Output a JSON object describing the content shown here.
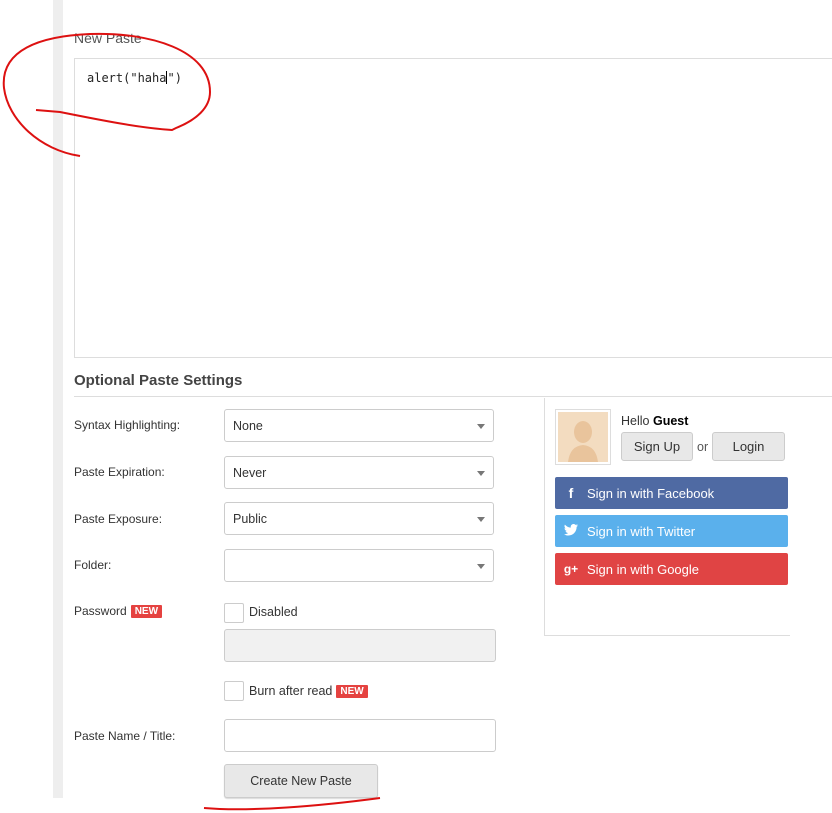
{
  "new_paste": {
    "title": "New Paste",
    "content": "alert(\"haha\")"
  },
  "settings": {
    "title": "Optional Paste Settings",
    "syntax_label": "Syntax Highlighting:",
    "syntax_value": "None",
    "expiration_label": "Paste Expiration:",
    "expiration_value": "Never",
    "exposure_label": "Paste Exposure:",
    "exposure_value": "Public",
    "folder_label": "Folder:",
    "folder_value": "",
    "password_label": "Password",
    "new_badge": "NEW",
    "password_checkbox_label": "Disabled",
    "burn_label": "Burn after read",
    "name_label": "Paste Name / Title:",
    "name_value": "",
    "create_button": "Create New Paste"
  },
  "account": {
    "hello": "Hello",
    "user": "Guest",
    "signup": "Sign Up",
    "or": "or",
    "login": "Login",
    "facebook": "Sign in with Facebook",
    "twitter": "Sign in with Twitter",
    "google": "Sign in with Google"
  },
  "colors": {
    "facebook": "#4f6aa3",
    "twitter": "#5ab0ec",
    "google": "#e04444",
    "badge": "#e54240",
    "annotation": "#dd1111"
  },
  "icons": [
    "facebook-icon",
    "twitter-icon",
    "google-plus-icon",
    "chevron-down-icon",
    "user-avatar-icon"
  ]
}
